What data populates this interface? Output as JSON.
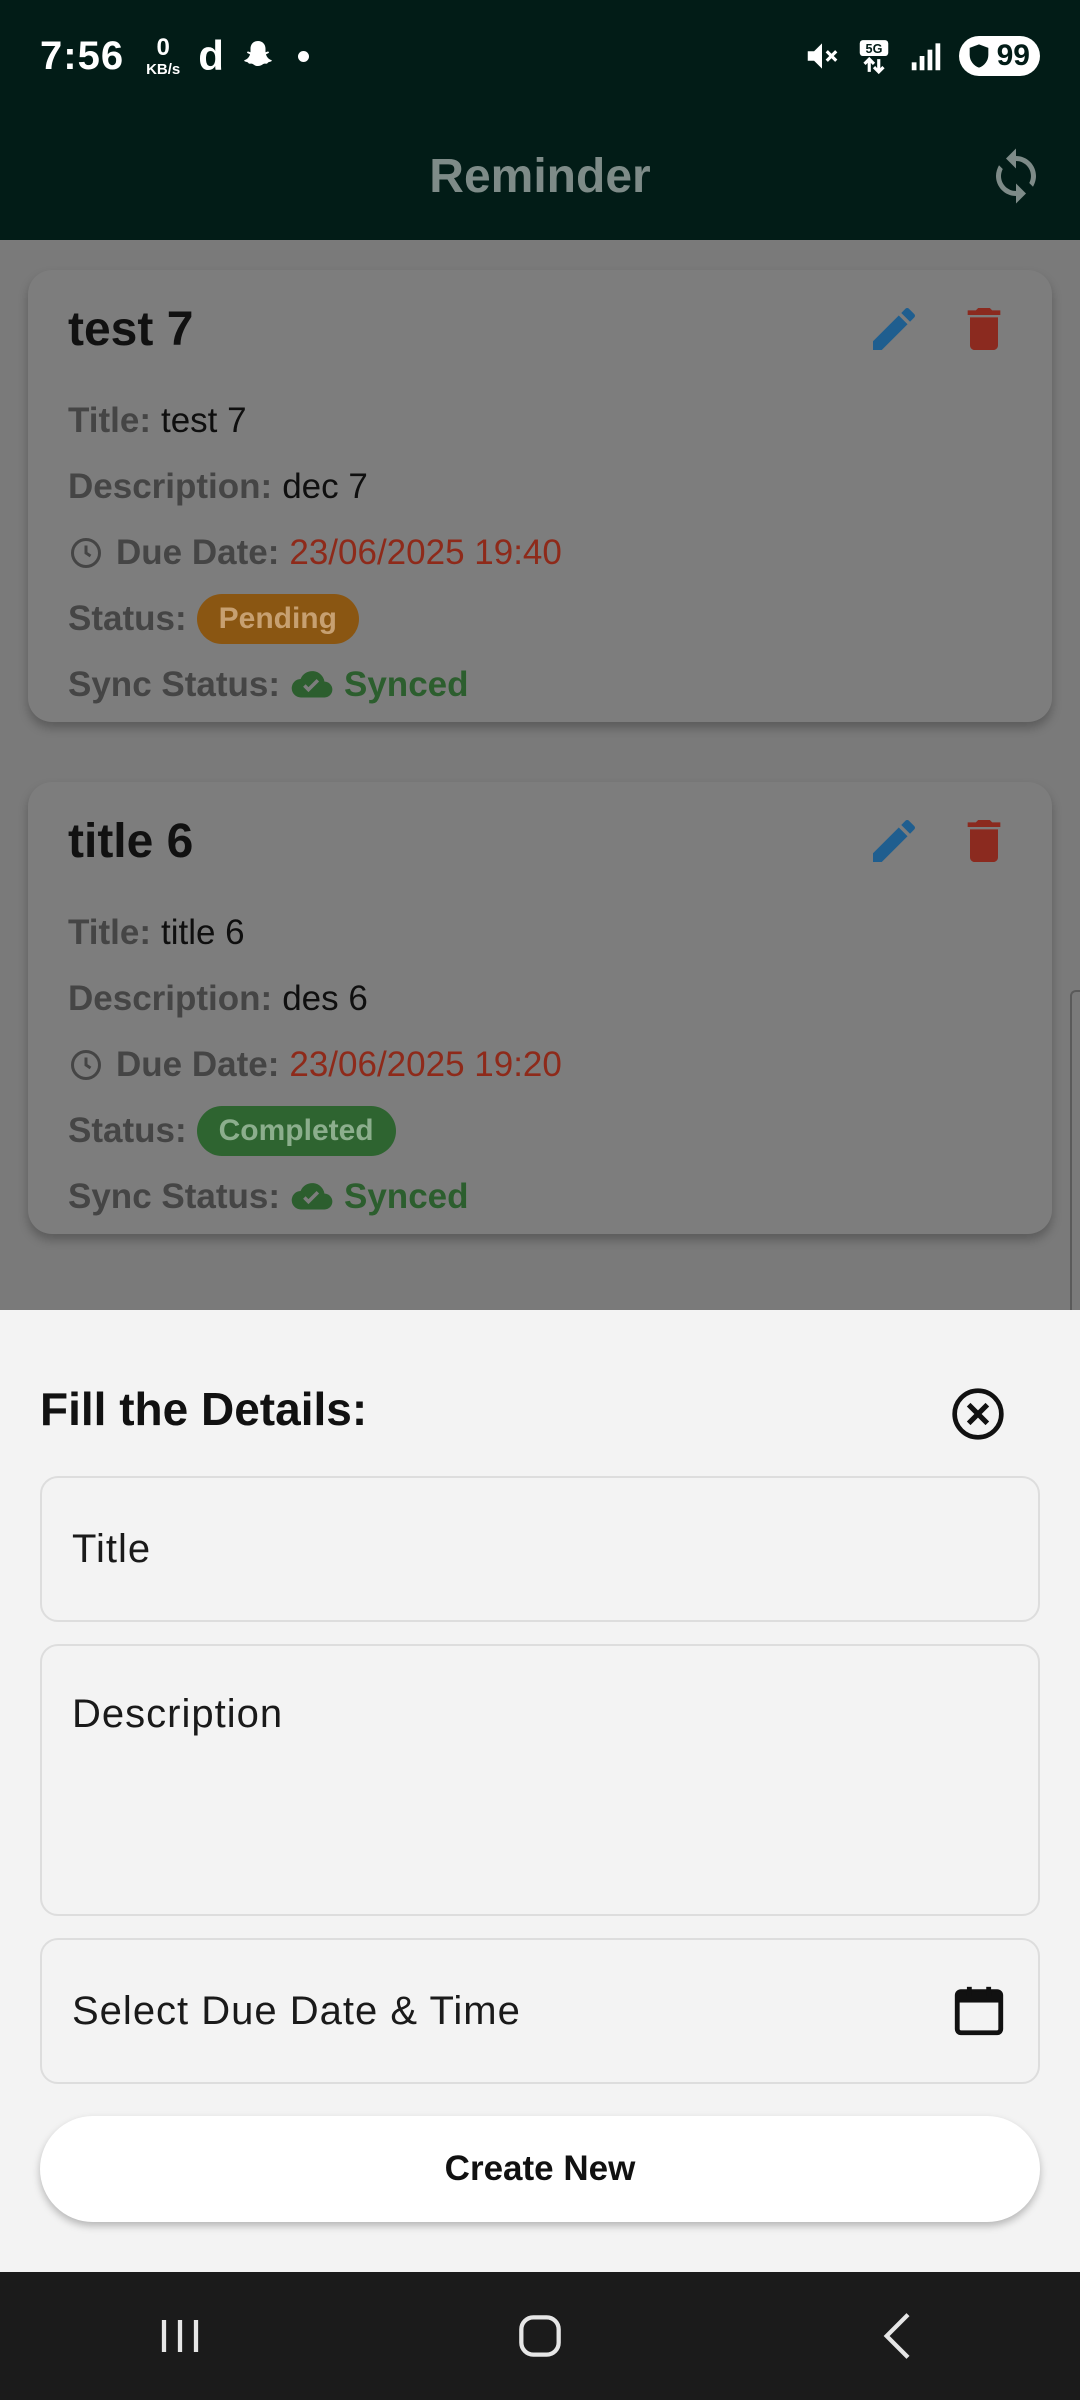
{
  "status_bar": {
    "time": "7:56",
    "net_speed_value": "0",
    "net_speed_unit": "KB/s",
    "app_letter": "d",
    "network": "5G",
    "battery": "99"
  },
  "app_bar": {
    "title": "Reminder"
  },
  "reminders": [
    {
      "heading": "test 7",
      "title_label": "Title:",
      "title": "test 7",
      "description_label": "Description:",
      "description": "dec 7",
      "due_label": "Due Date:",
      "due": "23/06/2025 19:40",
      "status_label": "Status:",
      "status": "Pending",
      "sync_label": "Sync Status:",
      "sync": "Synced"
    },
    {
      "heading": "title 6",
      "title_label": "Title:",
      "title": "title 6",
      "description_label": "Description:",
      "description": "des 6",
      "due_label": "Due Date:",
      "due": "23/06/2025 19:20",
      "status_label": "Status:",
      "status": "Completed",
      "sync_label": "Sync Status:",
      "sync": "Synced"
    }
  ],
  "sheet": {
    "title": "Fill the Details:",
    "title_placeholder": "Title",
    "description_placeholder": "Description",
    "date_placeholder": "Select Due Date & Time",
    "create_label": "Create New"
  },
  "colors": {
    "app_bar": "#021c17",
    "edit": "#1f5e8f",
    "delete": "#8b2a1f",
    "due_date": "#8e2a1a",
    "pending": "#8a5612",
    "completed": "#2e6430",
    "synced": "#2c5e2e"
  }
}
